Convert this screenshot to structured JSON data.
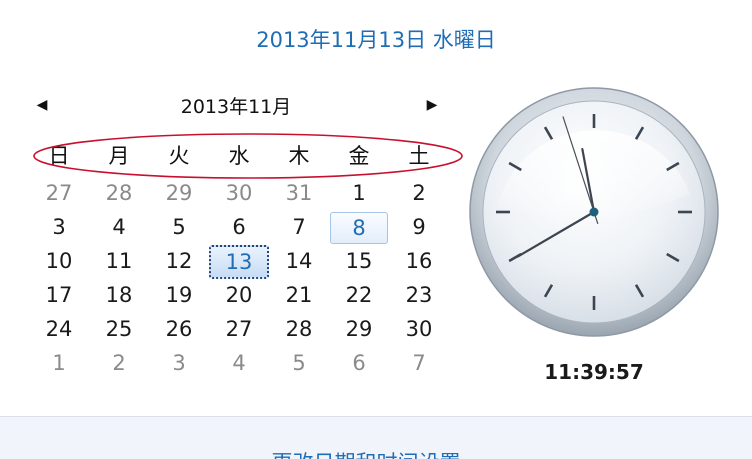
{
  "header": {
    "full_date": "2013年11月13日 水曜日"
  },
  "calendar": {
    "month_title": "2013年11月",
    "prev_label": "◀",
    "next_label": "▶",
    "weekdays": [
      "日",
      "月",
      "火",
      "水",
      "木",
      "金",
      "土"
    ],
    "weeks": [
      [
        {
          "d": "27",
          "o": true
        },
        {
          "d": "28",
          "o": true
        },
        {
          "d": "29",
          "o": true
        },
        {
          "d": "30",
          "o": true
        },
        {
          "d": "31",
          "o": true
        },
        {
          "d": "1"
        },
        {
          "d": "2"
        }
      ],
      [
        {
          "d": "3"
        },
        {
          "d": "4"
        },
        {
          "d": "5"
        },
        {
          "d": "6"
        },
        {
          "d": "7"
        },
        {
          "d": "8",
          "h": true
        },
        {
          "d": "9"
        }
      ],
      [
        {
          "d": "10"
        },
        {
          "d": "11"
        },
        {
          "d": "12"
        },
        {
          "d": "13",
          "t": true
        },
        {
          "d": "14"
        },
        {
          "d": "15"
        },
        {
          "d": "16"
        }
      ],
      [
        {
          "d": "17"
        },
        {
          "d": "18"
        },
        {
          "d": "19"
        },
        {
          "d": "20"
        },
        {
          "d": "21"
        },
        {
          "d": "22"
        },
        {
          "d": "23"
        }
      ],
      [
        {
          "d": "24"
        },
        {
          "d": "25"
        },
        {
          "d": "26"
        },
        {
          "d": "27"
        },
        {
          "d": "28"
        },
        {
          "d": "29"
        },
        {
          "d": "30"
        }
      ],
      [
        {
          "d": "1",
          "o": true
        },
        {
          "d": "2",
          "o": true
        },
        {
          "d": "3",
          "o": true
        },
        {
          "d": "4",
          "o": true
        },
        {
          "d": "5",
          "o": true
        },
        {
          "d": "6",
          "o": true
        },
        {
          "d": "7",
          "o": true
        }
      ]
    ]
  },
  "clock": {
    "time_text": "11:39:57",
    "hours": 11,
    "minutes": 39,
    "seconds": 57
  },
  "footer": {
    "change_link": "更改日期和时间设置..."
  },
  "colors": {
    "link": "#1f6db4",
    "annotation": "#c8102e"
  }
}
